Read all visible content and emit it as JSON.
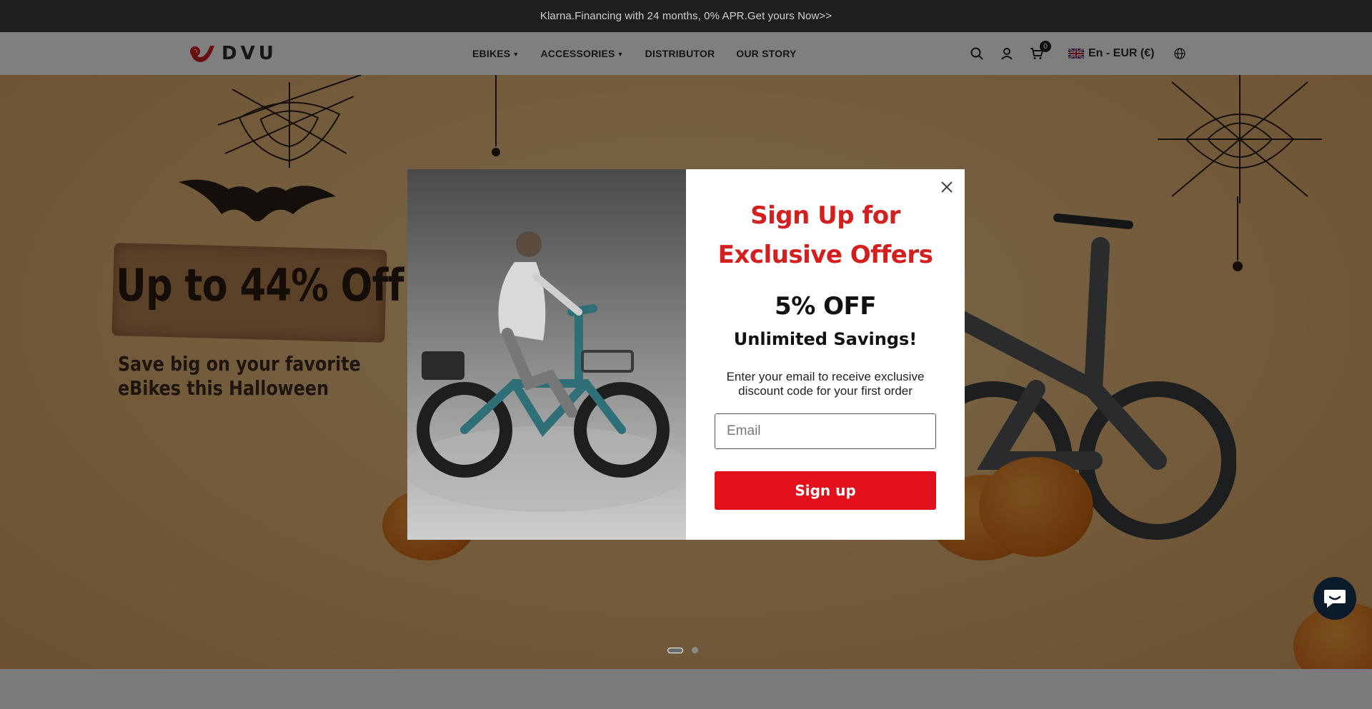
{
  "announcement": {
    "text": "Klarna.Financing with 24 months, 0% APR.Get yours Now>>"
  },
  "header": {
    "logo_text": "DVU",
    "nav": [
      {
        "label": "EBIKES",
        "has_dropdown": true
      },
      {
        "label": "ACCESSORIES",
        "has_dropdown": true
      },
      {
        "label": "DISTRIBUTOR",
        "has_dropdown": false
      },
      {
        "label": "OUR STORY",
        "has_dropdown": false
      }
    ],
    "icons": [
      "search-icon",
      "account-icon",
      "cart-icon",
      "globe-icon"
    ],
    "cart_count": "0",
    "locale": "En - EUR (€)"
  },
  "hero": {
    "headline": "Up to 44% Off",
    "subline_1": "Save big on your favorite",
    "subline_2": "eBikes this Halloween",
    "slides": 2,
    "active_slide": 1
  },
  "modal": {
    "title_line_1": "Sign Up for",
    "title_line_2": "Exclusive Offers",
    "discount": "5% OFF",
    "savings": "Unlimited Savings!",
    "description": "Enter your email to receive exclusive discount code for your first order",
    "email_placeholder": "Email",
    "email_value": "",
    "submit_label": "Sign up"
  },
  "colors": {
    "accent_red": "#e3101c",
    "title_red": "#d51f1f",
    "announcement_bg": "#1e1e1e",
    "chat_bg": "#0b1b2b"
  }
}
